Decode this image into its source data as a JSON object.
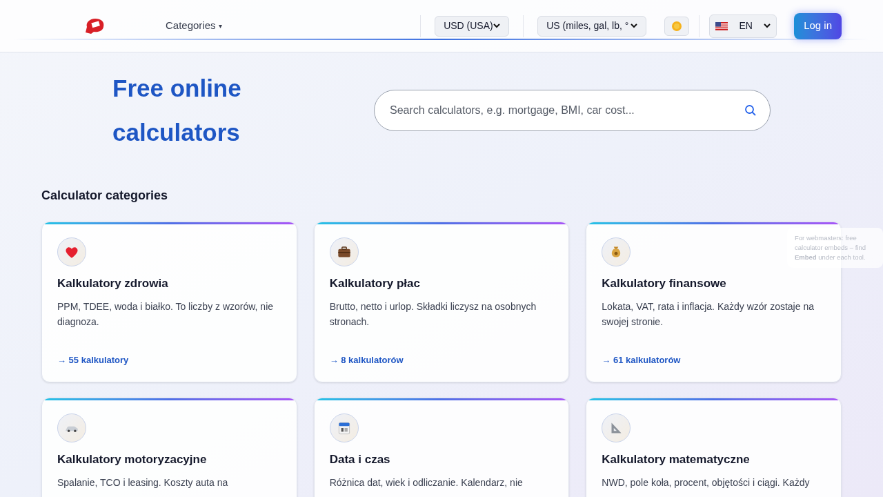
{
  "header": {
    "nav": [
      {
        "label": "Categories",
        "caret": "▾"
      }
    ],
    "currency": "USD (USA)",
    "units": "US (miles, gal, lb, °",
    "language": "EN",
    "login": "Log in"
  },
  "hero": {
    "title_lines": [
      "Free online",
      "calculators"
    ],
    "search": {
      "placeholder": "Search calculators, e.g. mortgage, BMI, car cost..."
    }
  },
  "webmaster_note": "For webmasters: free calculator embeds – find **Embed** under each tool.",
  "section_title": "Calculator categories",
  "categories": [
    {
      "kind": "heart",
      "title": "Kalkulatory zdrowia",
      "description": "PPM, TDEE, woda i białko. To liczby z wzorów, nie diagnoza.",
      "link": "→ 55 kalkulatory"
    },
    {
      "kind": "briefcase",
      "title": "Kalkulatory płac",
      "description": "Brutto, netto i urlop. Składki liczysz na osobnych stronach.",
      "link": "→ 8 kalkulatorów"
    },
    {
      "kind": "moneybag",
      "title": "Kalkulatory finansowe",
      "description": "Lokata, VAT, rata i inflacja. Każdy wzór zostaje na swojej stronie.",
      "link": "→ 61 kalkulatorów"
    },
    {
      "kind": "car",
      "title": "Kalkulatory motoryzacyjne",
      "description": "Spalanie, TCO i leasing. Koszty auta na"
    },
    {
      "kind": "calendar",
      "title": "Data i czas",
      "description": "Różnica dat, wiek i odliczanie. Kalendarz, nie"
    },
    {
      "kind": "ruler",
      "title": "Kalkulatory matematyczne",
      "description": "NWD, pole koła, procent, objętości i ciągi. Każdy"
    }
  ]
}
